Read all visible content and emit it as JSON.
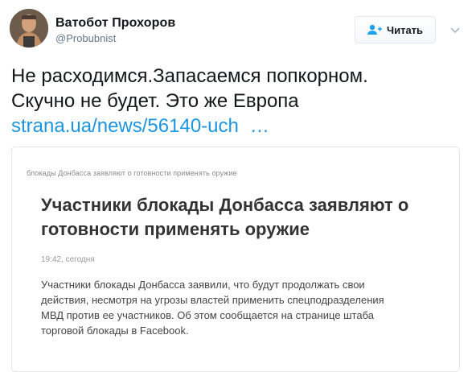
{
  "user": {
    "display_name": "Ватобот Прохоров",
    "handle": "@Probubnist",
    "avatar_icon": "profile-photo"
  },
  "actions": {
    "follow_label": "Читать",
    "follow_icon": "add-user-icon",
    "more_icon": "chevron-down-icon"
  },
  "tweet": {
    "lines": [
      "Не расходимся.Запасаемся попкорном.",
      "Скучно не будет. Это же Европа"
    ],
    "link_text": "strana.ua/news/56140-uch",
    "link_ellipsis": "…"
  },
  "card": {
    "breadcrumb": "блокады Донбасса заявляют о готовности применять оружие",
    "title": "Участники блокады Донбасса заявляют о готовности применять оружие",
    "time": "19:42, сегодня",
    "body_lines": [
      "Участники блокады Донбасса заявили, что будут продолжать свои",
      "действия, несмотря на угрозы властей применить спецподразделения",
      "МВД против ее участников. Об этом сообщается на странице штаба",
      "торговой блокады в Facebook."
    ]
  },
  "colors": {
    "link": "#1b95e0",
    "follow_icon": "#1da1f2",
    "text": "#14171a",
    "muted": "#657786"
  }
}
